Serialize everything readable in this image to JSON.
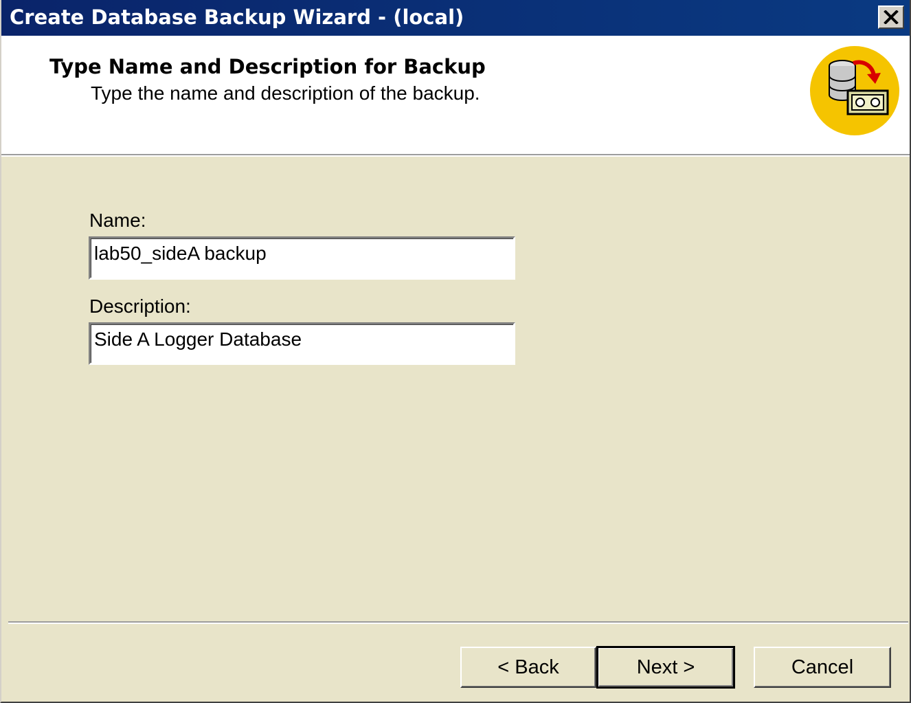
{
  "window": {
    "title": "Create Database Backup Wizard - (local)",
    "close_icon": "close-icon"
  },
  "header": {
    "title": "Type Name and Description for Backup",
    "subtitle": "Type the name and description of the backup.",
    "icon": "database-backup-icon"
  },
  "form": {
    "name_label": "Name:",
    "name_value": "lab50_sideA backup",
    "description_label": "Description:",
    "description_value": "Side A Logger Database"
  },
  "buttons": {
    "back": "< Back",
    "next": "Next >",
    "cancel": "Cancel"
  },
  "colors": {
    "titlebar": "#0a246a",
    "dialog_face": "#e8e4c9",
    "icon_badge": "#f5c400"
  }
}
